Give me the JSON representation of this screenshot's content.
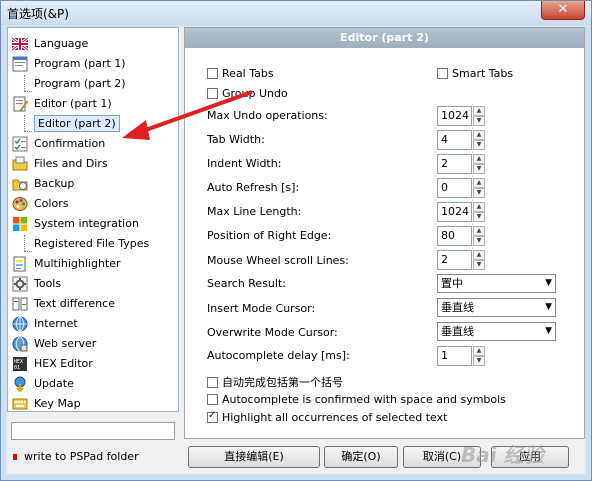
{
  "window": {
    "title": "首选项(&P)",
    "close_glyph": "✕"
  },
  "nav": {
    "items": [
      {
        "label": "Language",
        "icon": "uk-flag-icon"
      },
      {
        "label": "Program  (part 1)",
        "icon": "program-icon"
      },
      {
        "label": "Program  (part 2)",
        "icon": ""
      },
      {
        "label": "Editor  (part 1)",
        "icon": "editor-icon"
      },
      {
        "label": "Editor  (part 2)",
        "icon": ""
      },
      {
        "label": "Confirmation",
        "icon": "checklist-icon"
      },
      {
        "label": "Files and Dirs",
        "icon": "files-icon"
      },
      {
        "label": "Backup",
        "icon": "backup-icon"
      },
      {
        "label": "Colors",
        "icon": "palette-icon"
      },
      {
        "label": "System integration",
        "icon": "windows-icon"
      },
      {
        "label": "Registered File Types",
        "icon": ""
      },
      {
        "label": "Multihighlighter",
        "icon": "highlighter-icon"
      },
      {
        "label": "Tools",
        "icon": "tools-icon"
      },
      {
        "label": "Text difference",
        "icon": "text-diff-icon"
      },
      {
        "label": "Internet",
        "icon": "globe-icon"
      },
      {
        "label": "Web server",
        "icon": "web-server-icon"
      },
      {
        "label": "HEX Editor",
        "icon": "hex-icon"
      },
      {
        "label": "Update",
        "icon": "update-icon"
      },
      {
        "label": "Key Map",
        "icon": "keyboard-icon"
      }
    ],
    "write_folder": "write to PSPad folder"
  },
  "panel": {
    "title": "Editor  (part 2)",
    "real_tabs": {
      "label": "Real Tabs",
      "checked": false
    },
    "smart_tabs": {
      "label": "Smart Tabs",
      "checked": false
    },
    "group_undo": {
      "label": "Group Undo",
      "checked": false
    },
    "max_undo": {
      "label": "Max Undo operations:",
      "value": "1024"
    },
    "tab_width": {
      "label": "Tab Width:",
      "value": "4"
    },
    "indent_width": {
      "label": "Indent Width:",
      "value": "2"
    },
    "auto_refresh": {
      "label": "Auto Refresh [s]:",
      "value": "0"
    },
    "max_line_length": {
      "label": "Max Line Length:",
      "value": "1024"
    },
    "right_edge": {
      "label": "Position of Right Edge:",
      "value": "80"
    },
    "wheel_lines": {
      "label": "Mouse Wheel scroll Lines:",
      "value": "2"
    },
    "search_result": {
      "label": "Search Result:",
      "value": "置中"
    },
    "insert_cursor": {
      "label": "Insert Mode Cursor:",
      "value": "垂直线"
    },
    "overwrite_cursor": {
      "label": "Overwrite Mode Cursor:",
      "value": "垂直线"
    },
    "autocomplete_delay": {
      "label": "Autocomplete delay [ms]:",
      "value": "1"
    },
    "auto_bracket": {
      "label": "自动完成包括第一个括号",
      "checked": false
    },
    "autocomplete_confirm": {
      "label": "Autocomplete is confirmed with space and symbols",
      "checked": false
    },
    "highlight_all": {
      "label": "Highlight all occurrences of selected text",
      "checked": true
    }
  },
  "buttons": {
    "direct_edit": "直接编辑(E)",
    "ok": "确定(O)",
    "cancel": "取消(C)",
    "apply": "应用"
  },
  "watermark": "Bai 经验"
}
